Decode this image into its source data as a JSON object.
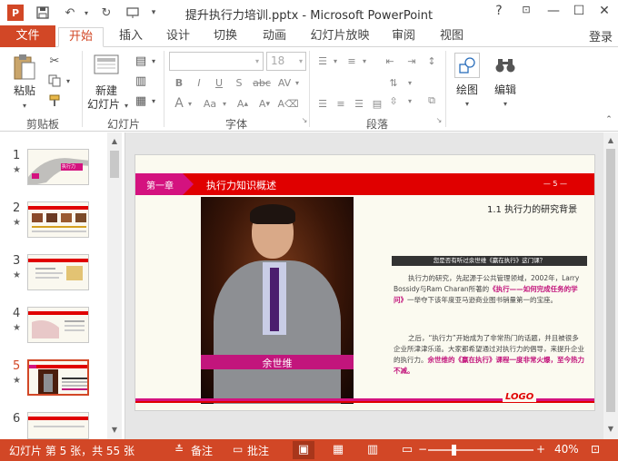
{
  "window": {
    "title": "提升执行力培训.pptx - Microsoft PowerPoint",
    "help": "?"
  },
  "tabs": {
    "file": "文件",
    "items": [
      "开始",
      "插入",
      "设计",
      "切换",
      "动画",
      "幻灯片放映",
      "审阅",
      "视图"
    ],
    "login": "登录"
  },
  "ribbon": {
    "paste": "粘贴",
    "new_slide_line1": "新建",
    "new_slide_line2": "幻灯片",
    "font_size": "18",
    "draw": "绘图",
    "edit": "编辑",
    "groups": [
      "剪贴板",
      "幻灯片",
      "字体",
      "段落"
    ]
  },
  "thumbs": {
    "numbers": [
      "1",
      "2",
      "3",
      "4",
      "5",
      "6"
    ],
    "star": "★",
    "thumb1_label": "执行力"
  },
  "slide": {
    "chapter": "第一章",
    "header_title": "执行力知识概述",
    "page_mark": "— 5 —",
    "section_title": "1.1 执行力的研究背景",
    "person_name": "余世维",
    "question": "您是否有听过余世维《赢在执行》这门课？",
    "para1_a": "执行力的研究，先起源于公共管理领域，2002年，Larry Bossidy与Ram Charan所著的",
    "para1_hl": "《执行——如何完成任务的学问》",
    "para1_b": "一举夺下该年度亚马逊商业图书销量第一的宝座。",
    "para2_a": "之后，“执行力”开始成为了非常热门的话题，并且被很多企业所津津乐道。大家都希望通过对执行力的倡导，来提升企业的执行力。",
    "para2_hl": "余世维的《赢在执行》课程一度非常火爆，至今热力不减。",
    "logo": "LOGO"
  },
  "status": {
    "slide_info": "幻灯片 第 5 张，共 55 张",
    "notes": "备注",
    "comments": "批注",
    "zoom_minus": "−",
    "zoom_plus": "+",
    "zoom": "40%"
  },
  "colors": {
    "accent": "#d24726",
    "slide_red": "#e00000",
    "slide_magenta": "#d4127f"
  }
}
